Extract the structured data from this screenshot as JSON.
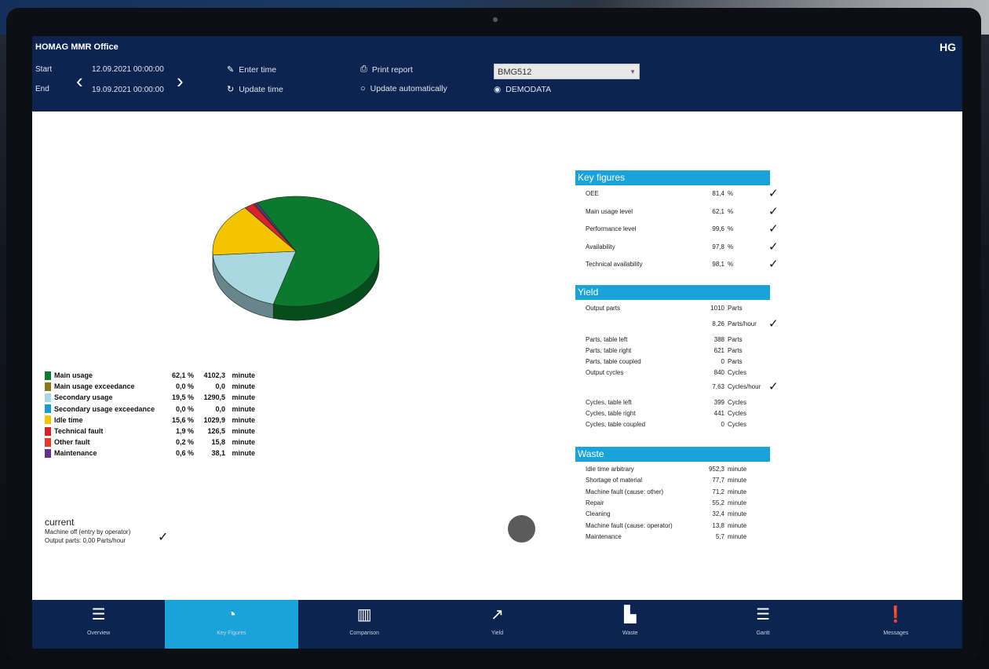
{
  "app": {
    "title": "HOMAG MMR Office",
    "logo": "HG"
  },
  "header": {
    "start_label": "Start",
    "end_label": "End",
    "start_value": "12.09.2021 00:00:00",
    "end_value": "19.09.2021 00:00:00",
    "enter_time": "Enter time",
    "update_time": "Update time",
    "print_report": "Print report",
    "update_automatically": "Update automatically",
    "machine_select": "BMG512",
    "demodata": "DEMODATA"
  },
  "chart_data": {
    "type": "pie",
    "title": "",
    "slices": [
      {
        "name": "Main usage",
        "percent": 62.1,
        "value": 4102.3,
        "color": "#0b7a2e"
      },
      {
        "name": "Main usage exceedance",
        "percent": 0.0,
        "value": 0.0,
        "color": "#8a7a1e"
      },
      {
        "name": "Secondary usage",
        "percent": 19.5,
        "value": 1290.5,
        "color": "#a9d7e2"
      },
      {
        "name": "Secondary usage exceedance",
        "percent": 0.0,
        "value": 0.0,
        "color": "#1a9ad6"
      },
      {
        "name": "Idle time",
        "percent": 15.6,
        "value": 1029.9,
        "color": "#f5c400"
      },
      {
        "name": "Technical fault",
        "percent": 1.9,
        "value": 126.5,
        "color": "#d8232a"
      },
      {
        "name": "Other fault",
        "percent": 0.2,
        "value": 15.8,
        "color": "#e23a2a"
      },
      {
        "name": "Maintenance",
        "percent": 0.6,
        "value": 38.1,
        "color": "#6a2e8c"
      }
    ]
  },
  "legend": {
    "rows": [
      {
        "name": "Main usage",
        "pct": "62,1 %",
        "val": "4102,3",
        "unit": "minute",
        "color": "#0b7a2e"
      },
      {
        "name": "Main usage exceedance",
        "pct": "0,0 %",
        "val": "0,0",
        "unit": "minute",
        "color": "#8a7a1e"
      },
      {
        "name": "Secondary usage",
        "pct": "19,5 %",
        "val": "1290,5",
        "unit": "minute",
        "color": "#a9d7e2"
      },
      {
        "name": "Secondary usage exceedance",
        "pct": "0,0 %",
        "val": "0,0",
        "unit": "minute",
        "color": "#1a9ad6"
      },
      {
        "name": "Idle time",
        "pct": "15,6 %",
        "val": "1029,9",
        "unit": "minute",
        "color": "#f5c400"
      },
      {
        "name": "Technical fault",
        "pct": "1,9 %",
        "val": "126,5",
        "unit": "minute",
        "color": "#d8232a"
      },
      {
        "name": "Other fault",
        "pct": "0,2 %",
        "val": "15,8",
        "unit": "minute",
        "color": "#e23a2a"
      },
      {
        "name": "Maintenance",
        "pct": "0,6 %",
        "val": "38,1",
        "unit": "minute",
        "color": "#6a2e8c"
      }
    ]
  },
  "current": {
    "title": "current",
    "line1": "Machine off (entry by operator)",
    "line2": "Output parts: 0,00 Parts/hour"
  },
  "key_figures": {
    "title": "Key figures",
    "rows": [
      {
        "name": "OEE",
        "value": "81,4",
        "unit": "%",
        "check": true
      },
      {
        "name": "Main usage level",
        "value": "62,1",
        "unit": "%",
        "check": true
      },
      {
        "name": "Performance level",
        "value": "99,6",
        "unit": "%",
        "check": true
      },
      {
        "name": "Availability",
        "value": "97,8",
        "unit": "%",
        "check": true
      },
      {
        "name": "Technical availability",
        "value": "98,1",
        "unit": "%",
        "check": true
      }
    ]
  },
  "yield": {
    "title": "Yield",
    "rows": [
      {
        "name": "Output parts",
        "value": "1010",
        "unit": "Parts",
        "check": false
      },
      {
        "name": "",
        "value": "8,26",
        "unit": "Parts/hour",
        "check": true
      },
      {
        "name": "Parts, table left",
        "value": "388",
        "unit": "Parts",
        "check": false
      },
      {
        "name": "Parts, table right",
        "value": "621",
        "unit": "Parts",
        "check": false
      },
      {
        "name": "Parts, table coupled",
        "value": "0",
        "unit": "Parts",
        "check": false
      },
      {
        "name": "Output cycles",
        "value": "840",
        "unit": "Cycles",
        "check": false
      },
      {
        "name": "",
        "value": "7,63",
        "unit": "Cycles/hour",
        "check": true
      },
      {
        "name": "Cycles, table left",
        "value": "399",
        "unit": "Cycles",
        "check": false
      },
      {
        "name": "Cycles, table right",
        "value": "441",
        "unit": "Cycles",
        "check": false
      },
      {
        "name": "Cycles, table coupled",
        "value": "0",
        "unit": "Cycles",
        "check": false
      }
    ]
  },
  "waste": {
    "title": "Waste",
    "rows": [
      {
        "name": "Idle time arbitrary",
        "value": "952,3",
        "unit": "minute"
      },
      {
        "name": "Shortage of material",
        "value": "77,7",
        "unit": "minute"
      },
      {
        "name": "Machine fault (cause: other)",
        "value": "71,2",
        "unit": "minute"
      },
      {
        "name": "Repair",
        "value": "55,2",
        "unit": "minute"
      },
      {
        "name": "Cleaning",
        "value": "32,4",
        "unit": "minute"
      },
      {
        "name": "Machine fault (cause: operator)",
        "value": "13,8",
        "unit": "minute"
      },
      {
        "name": "Maintenance",
        "value": "5,7",
        "unit": "minute"
      }
    ]
  },
  "nav": {
    "items": [
      {
        "label": "Overview",
        "icon": "list-icon",
        "glyph": "☰",
        "active": false
      },
      {
        "label": "Key Figures",
        "icon": "pie-chart-icon",
        "glyph": "◔",
        "active": true
      },
      {
        "label": "Comparison",
        "icon": "bar-chart-icon",
        "glyph": "▥",
        "active": false
      },
      {
        "label": "Yield",
        "icon": "trend-icon",
        "glyph": "↗",
        "active": false
      },
      {
        "label": "Waste",
        "icon": "waste-chart-icon",
        "glyph": "▙",
        "active": false
      },
      {
        "label": "Gantt",
        "icon": "gantt-icon",
        "glyph": "☰",
        "active": false
      },
      {
        "label": "Messages",
        "icon": "alert-icon",
        "glyph": "❗",
        "active": false
      }
    ]
  }
}
